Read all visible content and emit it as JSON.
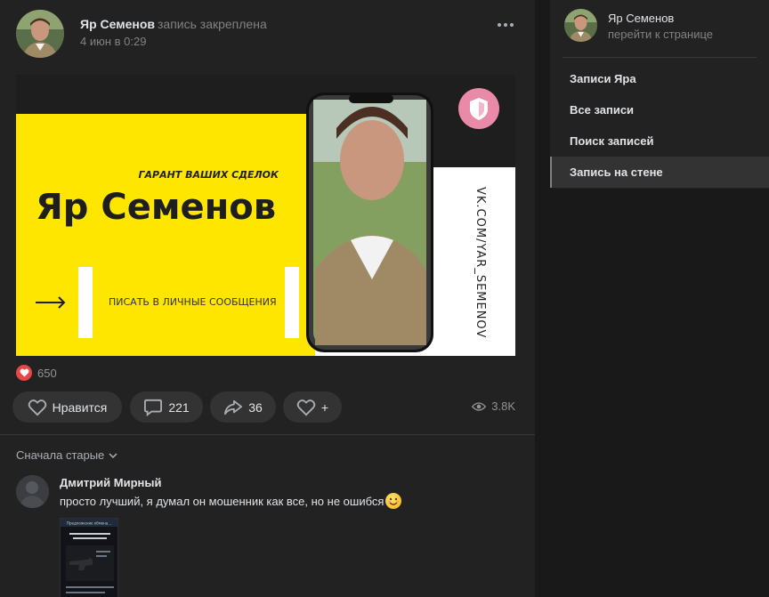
{
  "post": {
    "author": "Яр Семенов",
    "pinned_note": "запись закреплена",
    "date": "4 июн в 0:29",
    "banner": {
      "tagline": "ГАРАНТ ВАШИХ СДЕЛОК",
      "name": "Яр Семенов",
      "cta": "ПИСАТЬ В ЛИЧНЫЕ СООБЩЕНИЯ",
      "url": "VK.COM/YAR_SEMENOV",
      "colors": {
        "yellow": "#ffe600",
        "dark": "#1e1e1e",
        "badge": "#e88aa8"
      }
    },
    "reactions_count": "650",
    "actions": {
      "like_label": "Нравится",
      "comments_count": "221",
      "shares_count": "36",
      "add_reaction": "+"
    },
    "views": "3.8K"
  },
  "comments": {
    "sort_label": "Сначала старые",
    "items": [
      {
        "author": "Дмитрий Мирный",
        "text": "просто лучший, я думал он мошенник как все, но не ошибся",
        "attachment_title": "Предложение обмена..."
      }
    ]
  },
  "sidebar": {
    "name": "Яр Семенов",
    "link": "перейти к странице",
    "items": [
      {
        "label": "Записи Яра"
      },
      {
        "label": "Все записи"
      },
      {
        "label": "Поиск записей"
      },
      {
        "label": "Запись на стене"
      }
    ],
    "active_index": 3
  },
  "icons": [
    "more-icon",
    "heart-icon",
    "comment-icon",
    "share-icon",
    "eye-icon",
    "chevron-down-icon",
    "arrow-right-icon",
    "shield-icon"
  ],
  "colors": {
    "bg": "#19191a",
    "card": "#222222",
    "button": "#333333",
    "text": "#e1e3e6",
    "muted": "#828282",
    "like": "#e64646"
  }
}
